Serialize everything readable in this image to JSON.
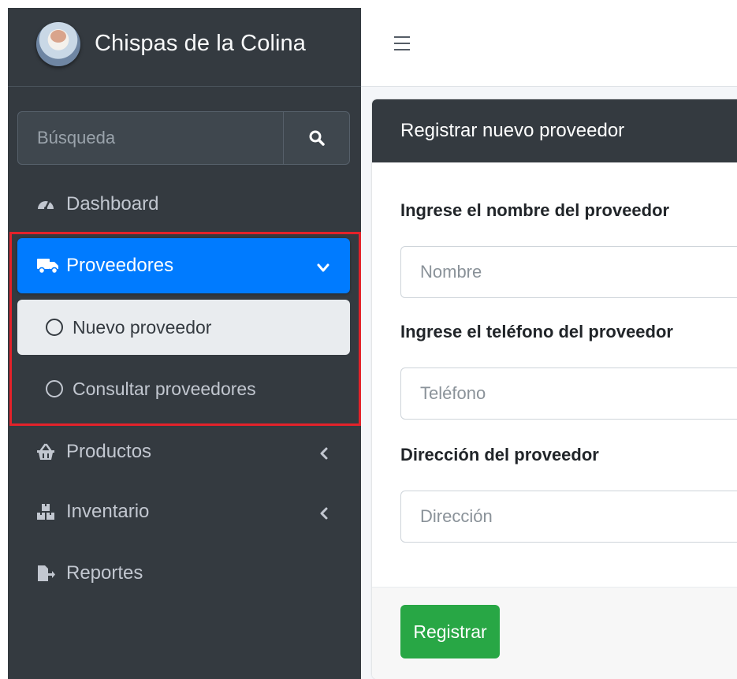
{
  "brand": {
    "title": "Chispas de la Colina"
  },
  "search": {
    "placeholder": "Búsqueda"
  },
  "sidebar": {
    "items": [
      {
        "label": "Dashboard",
        "icon": "tachometer-icon"
      },
      {
        "label": "Proveedores",
        "icon": "truck-icon",
        "active": true,
        "expanded": true,
        "children": [
          {
            "label": "Nuevo proveedor",
            "active": true
          },
          {
            "label": "Consultar proveedores"
          }
        ]
      },
      {
        "label": "Productos",
        "icon": "basket-icon"
      },
      {
        "label": "Inventario",
        "icon": "boxes-icon"
      },
      {
        "label": "Reportes",
        "icon": "file-export-icon"
      }
    ]
  },
  "card": {
    "title": "Registrar nuevo proveedor",
    "fields": [
      {
        "label": "Ingrese el nombre del proveedor",
        "placeholder": "Nombre",
        "value": ""
      },
      {
        "label": "Ingrese el teléfono del proveedor",
        "placeholder": "Teléfono",
        "value": ""
      },
      {
        "label": "Dirección del proveedor",
        "placeholder": "Dirección",
        "value": ""
      }
    ],
    "submit_label": "Registrar"
  },
  "colors": {
    "sidebar_bg": "#343a40",
    "active_blue": "#007bff",
    "submit_green": "#28a745",
    "highlight_red": "#e3222a"
  }
}
